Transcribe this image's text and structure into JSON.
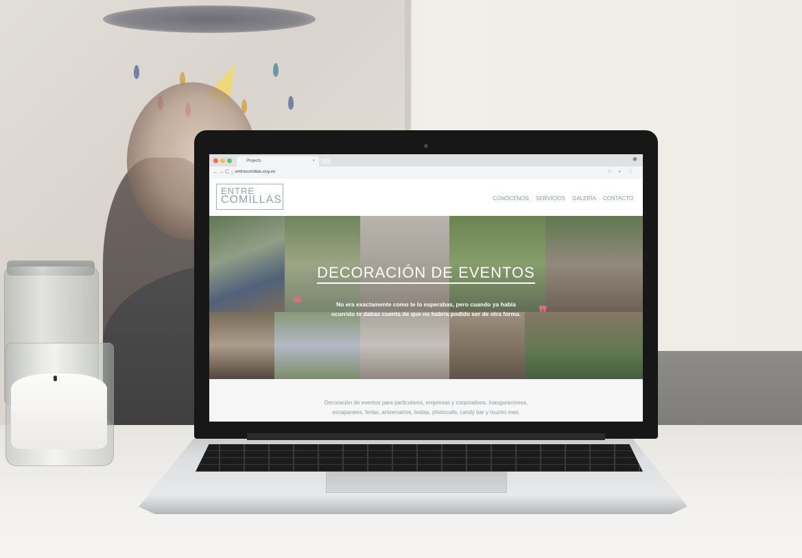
{
  "browser": {
    "tab_title": "Projects",
    "tab_close": "×",
    "url": "entrecomillas.esy.es",
    "nav_back": "←",
    "nav_forward": "→",
    "nav_reload": "C",
    "nav_info": "ⓘ",
    "account_icon": "user-icon",
    "addr_icons": "☆ ◐ ⋮"
  },
  "site": {
    "logo_top": "ENTRE",
    "logo_bottom": "COMILLAS",
    "nav": [
      "CONÓCENOS",
      "SERVICIOS",
      "GALERÍA",
      "CONTACTO"
    ],
    "hero_title": "DECORACIÓN DE EVENTOS",
    "hero_quote_line1": "No era exactamente como te lo esperabas, pero cuando ya había",
    "hero_quote_line2": "ocurrido te dabas cuenta de que no habría podido ser de otra forma.",
    "quote_open": "❝",
    "quote_close": "❞",
    "intro_line1": "Decoración de eventos para particulares, empresas y corporativos. Inauguraciones,",
    "intro_line2": "escaparates, ferias, aniversarios, bodas, photocalls, candy bar y mucho mas."
  },
  "colors": {
    "accent": "#8fa4a9",
    "quote_marks": "#e06d7a"
  }
}
